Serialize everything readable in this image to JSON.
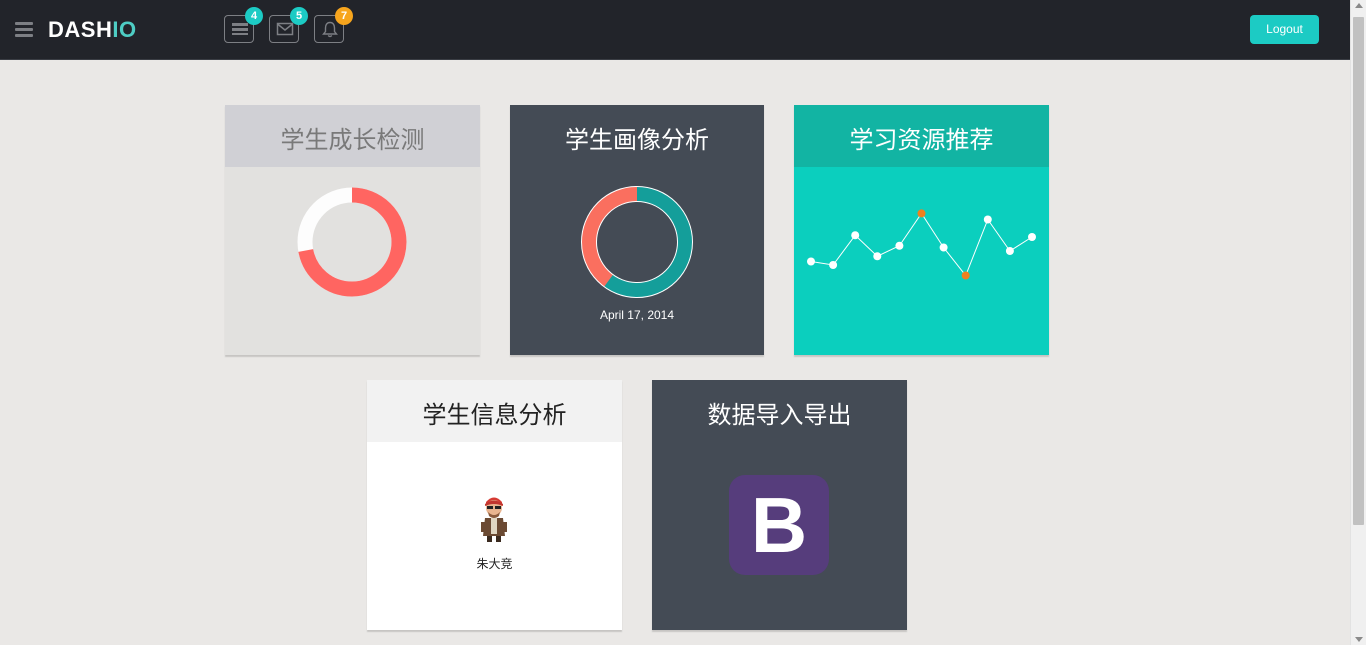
{
  "header": {
    "logo_part1": "DASH",
    "logo_part2": "IO",
    "nav_icons": [
      {
        "icon": "tasks-icon",
        "badge": "4",
        "badge_color": "#1ccbc4"
      },
      {
        "icon": "envelope-icon",
        "badge": "5",
        "badge_color": "#1ccbc4"
      },
      {
        "icon": "bell-icon",
        "badge": "7",
        "badge_color": "#f7a51d"
      }
    ],
    "logout_label": "Logout"
  },
  "panels": {
    "growth": {
      "title": "学生成长检测",
      "donut": {
        "accent": "#ff6561",
        "base": "#fdfdfd",
        "value_fraction": 0.72
      }
    },
    "profile": {
      "title": "学生画像分析",
      "donut": {
        "primary": "#149e9a",
        "secondary": "#fa6f5f",
        "primary_fraction": 0.6
      },
      "date": "April 17, 2014"
    },
    "resources": {
      "title": "学习资源推荐",
      "sparkline": {
        "values": [
          4.0,
          3.6,
          7.0,
          4.6,
          5.8,
          9.5,
          5.6,
          2.4,
          8.8,
          5.2,
          6.8
        ],
        "highlight_indices": [
          5,
          7
        ],
        "point_color": "#ffffff",
        "highlight_color": "#f0801d"
      }
    },
    "info": {
      "title": "学生信息分析",
      "user_name": "朱大竞"
    },
    "data": {
      "title": "数据导入导出",
      "logo_letter": "B",
      "logo_color": "#563d7c"
    }
  }
}
